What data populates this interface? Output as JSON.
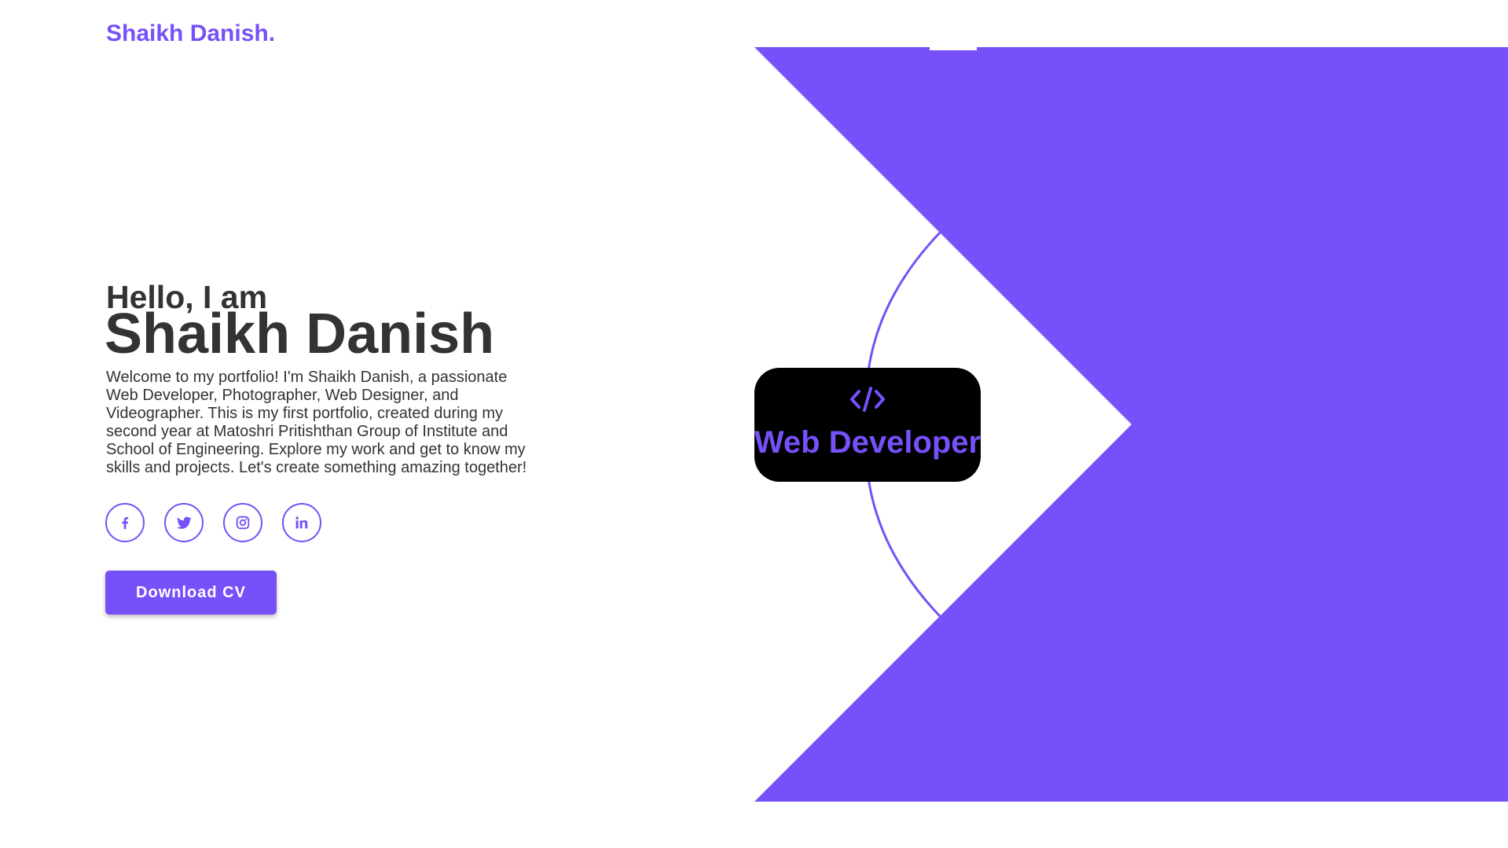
{
  "header": {
    "logo": "Shaikh Danish."
  },
  "hero": {
    "greeting": "Hello, I am",
    "name": "Shaikh Danish",
    "bio": "Welcome to my portfolio! I'm Shaikh Danish, a passionate Web Developer, Photographer, Web Designer, and Videographer. This is my first portfolio, created during my second year at Matoshri Pritishthan Group of Institute and School of Engineering. Explore my work and get to know my skills and projects. Let's create something amazing together!",
    "download_cv_label": "Download CV"
  },
  "socials": [
    {
      "icon": "facebook-icon"
    },
    {
      "icon": "twitter-icon"
    },
    {
      "icon": "instagram-icon"
    },
    {
      "icon": "linkedin-icon"
    }
  ],
  "role_card": {
    "icon": "code-icon",
    "label": "Web Developer"
  },
  "colors": {
    "accent": "#7650f8",
    "text": "#333333",
    "card_bg": "#000000",
    "background": "#ffffff"
  }
}
